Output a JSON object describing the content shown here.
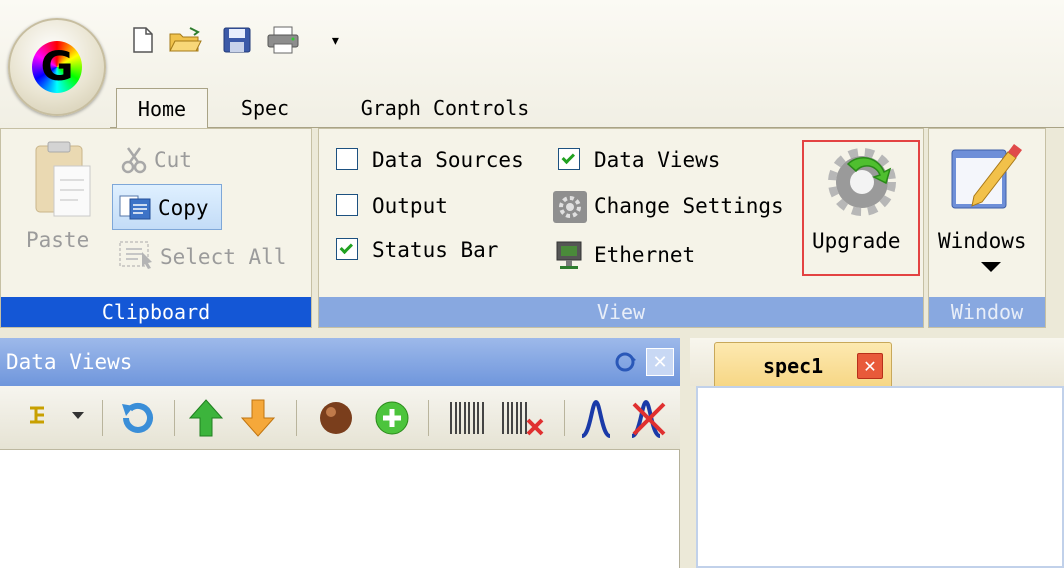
{
  "app": {
    "logo_letter": "G"
  },
  "quick_access": {
    "icons": [
      "new-file-icon",
      "open-folder-icon",
      "save-icon",
      "print-icon",
      "customize-dropdown-icon"
    ],
    "more_glyph": "▾"
  },
  "tabs": [
    {
      "label": "Home",
      "selected": true
    },
    {
      "label": "Spec",
      "selected": false
    },
    {
      "label": "Graph Controls",
      "selected": false
    }
  ],
  "ribbon": {
    "clipboard": {
      "group_label": "Clipboard",
      "paste": "Paste",
      "cut": "Cut",
      "copy": "Copy",
      "select_all": "Select All"
    },
    "view": {
      "group_label": "View",
      "data_sources": {
        "label": "Data Sources",
        "checked": false
      },
      "data_views": {
        "label": "Data Views",
        "checked": true
      },
      "output": {
        "label": "Output",
        "checked": false
      },
      "change_settings": "Change Settings",
      "status_bar": {
        "label": "Status Bar",
        "checked": true
      },
      "ethernet": "Ethernet",
      "upgrade": "Upgrade"
    },
    "window": {
      "group_label": "Window",
      "windows": "Windows"
    }
  },
  "data_views_pane": {
    "title": "Data Views",
    "toolbar_icons": [
      "tree-dropdown-icon",
      "refresh-icon",
      "move-up-icon",
      "move-down-icon",
      "record-icon",
      "add-icon",
      "barcode-icon",
      "barcode-delete-icon",
      "peak-icon",
      "peak-delete-icon"
    ]
  },
  "document": {
    "tab_label": "spec1"
  },
  "colors": {
    "clipboard_group": "#1457d6",
    "view_group": "#88a8e0",
    "pane_header": "#7a9edf",
    "highlight_box": "#e34242",
    "doc_tab": "#f6d684"
  }
}
